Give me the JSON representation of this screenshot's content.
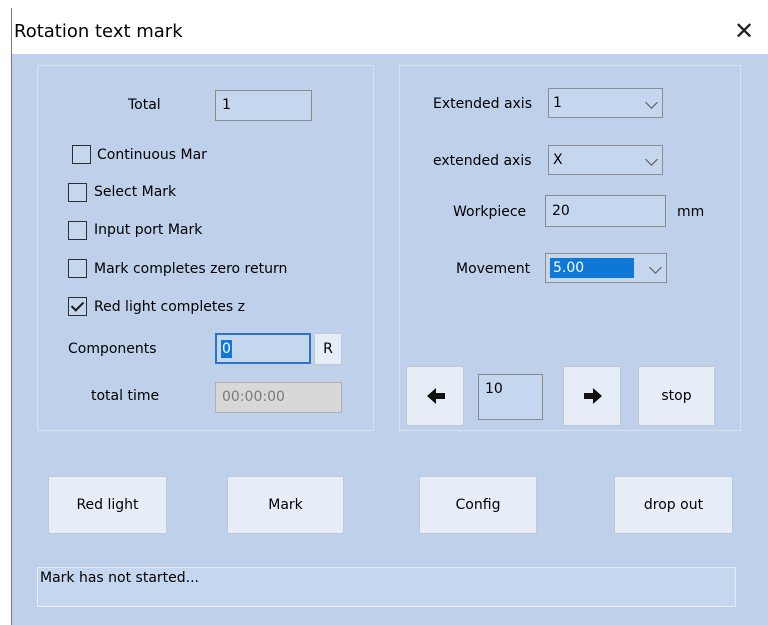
{
  "window": {
    "title": "Rotation text mark"
  },
  "left_panel": {
    "total": {
      "label": "Total",
      "value": "1"
    },
    "checkboxes": [
      {
        "label": "Continuous Mar",
        "checked": false
      },
      {
        "label": "Select Mark",
        "checked": false
      },
      {
        "label": "Input port Mark",
        "checked": false
      },
      {
        "label": "Mark completes zero return",
        "checked": false
      },
      {
        "label": "Red light completes z",
        "checked": true
      }
    ],
    "components": {
      "label": "Components",
      "value": "0",
      "button_label": "R"
    },
    "total_time": {
      "label": "total time",
      "value": "00:00:00"
    }
  },
  "right_panel": {
    "extended_axis_number": {
      "label": "Extended axis",
      "value": "1"
    },
    "extended_axis_type": {
      "label": "extended axis",
      "value": "X"
    },
    "workpiece": {
      "label": "Workpiece",
      "value": "20",
      "unit": "mm"
    },
    "movement": {
      "label": "Movement",
      "value": "5.00"
    },
    "jog": {
      "left_icon": "arrow-left-icon",
      "step_value": "10",
      "right_icon": "arrow-right-icon",
      "stop_label": "stop"
    }
  },
  "buttons": {
    "red_light": "Red light",
    "mark": "Mark",
    "config": "Config",
    "drop_out": "drop out"
  },
  "status": {
    "text": "Mark has not started..."
  },
  "colors": {
    "client_background": "#bed0ea",
    "field_background": "#c5d7ee",
    "button_background": "#e7edf7",
    "selection": "#0f78d7",
    "focus_border": "#2b73c9"
  }
}
